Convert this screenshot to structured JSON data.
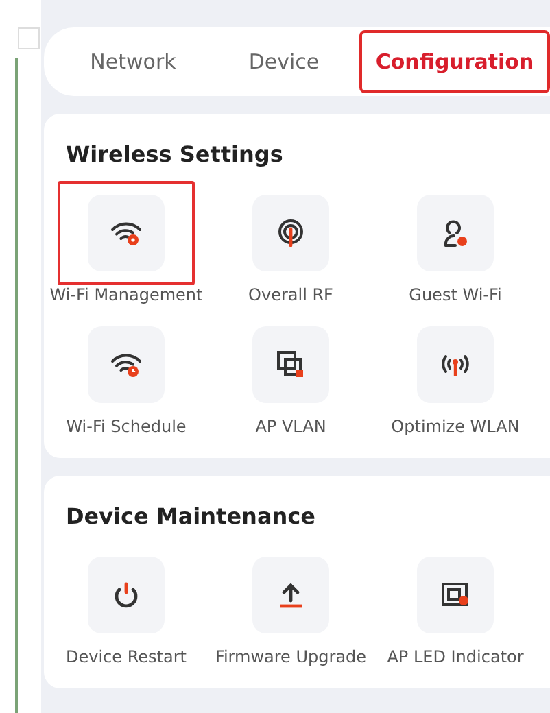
{
  "checkbox": {
    "checked": false
  },
  "tabs": [
    {
      "label": "Network",
      "selected": false
    },
    {
      "label": "Device",
      "selected": false
    },
    {
      "label": "Configuration",
      "selected": true
    }
  ],
  "sections": [
    {
      "title": "Wireless Settings",
      "items": [
        {
          "label": "Wi-Fi Management",
          "highlighted": true
        },
        {
          "label": "Overall RF",
          "highlighted": false
        },
        {
          "label": "Guest Wi-Fi",
          "highlighted": false
        },
        {
          "label": "Wi-Fi Schedule",
          "highlighted": false
        },
        {
          "label": "AP VLAN",
          "highlighted": false
        },
        {
          "label": "Optimize WLAN",
          "highlighted": false
        }
      ]
    },
    {
      "title": "Device Maintenance",
      "items": [
        {
          "label": "Device Restart",
          "highlighted": false
        },
        {
          "label": "Firmware Upgrade",
          "highlighted": false
        },
        {
          "label": "AP LED Indicator",
          "highlighted": false
        }
      ]
    }
  ]
}
